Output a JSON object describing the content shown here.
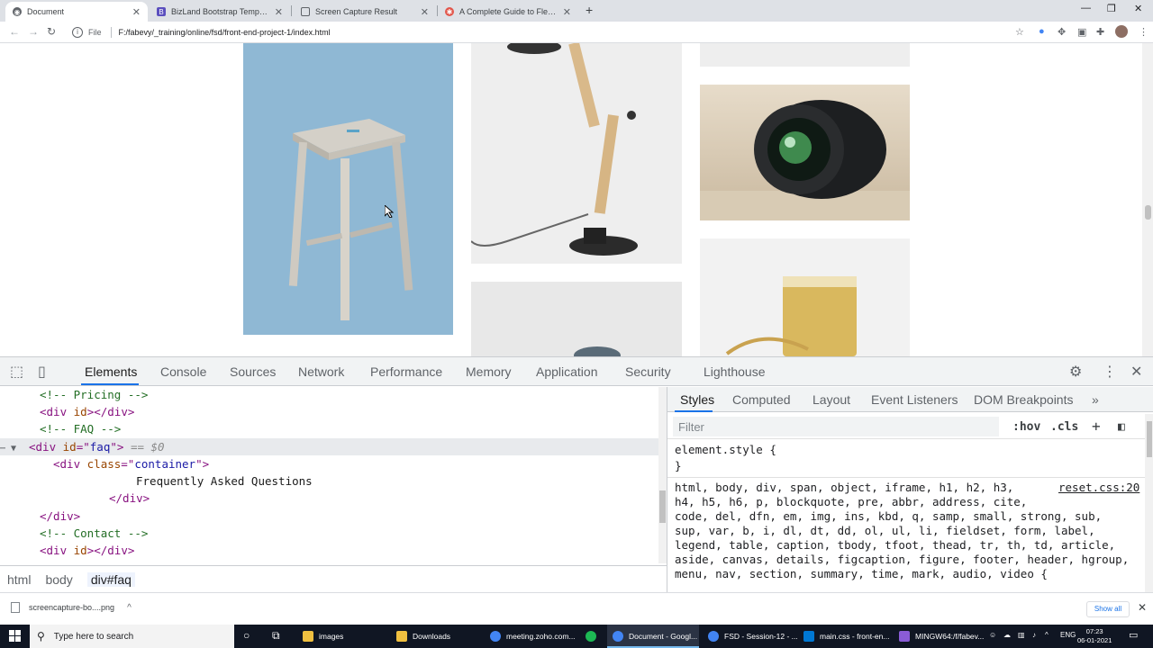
{
  "browser": {
    "tabs": [
      {
        "title": "Document",
        "active": true
      },
      {
        "title": "BizLand Bootstrap Template - Ind",
        "active": false
      },
      {
        "title": "Screen Capture Result",
        "active": false
      },
      {
        "title": "A Complete Guide to Flexbox | C",
        "active": false
      }
    ],
    "address": {
      "scheme_label": "File",
      "url": "F:/fabevy/_training/online/fsd/front-end-project-1/index.html"
    }
  },
  "devtools": {
    "tabs": [
      "Elements",
      "Console",
      "Sources",
      "Network",
      "Performance",
      "Memory",
      "Application",
      "Security",
      "Lighthouse"
    ],
    "active_tab": "Elements",
    "dom_lines": [
      {
        "comment": "<!-- Pricing -->"
      },
      {
        "tag": "div",
        "attr": "id",
        "value": ""
      },
      {
        "comment": "<!-- FAQ -->"
      },
      {
        "tag": "div",
        "attr": "id",
        "value": "faq",
        "selected_marker": "== $0"
      },
      {
        "tag": "div",
        "attr": "class",
        "value": "container"
      },
      {
        "text": "Frequently Asked Questions"
      },
      {
        "close": "</div>"
      },
      {
        "close": "</div>"
      },
      {
        "comment": "<!-- Contact -->"
      },
      {
        "tag": "div",
        "attr": "id",
        "value": ""
      }
    ],
    "breadcrumbs": [
      "html",
      "body",
      "div#faq"
    ],
    "styles_tabs": [
      "Styles",
      "Computed",
      "Layout",
      "Event Listeners",
      "DOM Breakpoints"
    ],
    "more_tabs": "»",
    "filter_placeholder": "Filter",
    "hov_label": ":hov",
    "cls_label": ".cls",
    "element_style_open": "element.style {",
    "element_style_close": "}",
    "reset_source": "reset.css:20",
    "reset_selectors": [
      "html, body, div, span, object, iframe, h1, h2, h3,",
      "h4, h5, h6, p, blockquote, pre, abbr, address, cite,",
      "code, del, dfn, em, img, ins, kbd, q, samp, small, strong, sub,",
      "sup, var, b, i, dl, dt, dd, ol, ul, li, fieldset, form, label,",
      "legend, table, caption, tbody, tfoot, thead, tr, th, td, article,",
      "aside, canvas, details, figcaption, figure, footer, header, hgroup,",
      "menu, nav, section, summary, time, mark, audio, video {"
    ]
  },
  "downloads": {
    "file": "screencapture-bo....png",
    "show_all": "Show all"
  },
  "taskbar": {
    "search_placeholder": "Type here to search",
    "apps": [
      {
        "label": "images",
        "color": "#f0c040"
      },
      {
        "label": "Downloads",
        "color": "#f0c040"
      },
      {
        "label": "meeting.zoho.com...",
        "color": "#4285f4"
      },
      {
        "label": "",
        "color": "#1db954"
      },
      {
        "label": "Document - Googl...",
        "color": "#4285f4"
      },
      {
        "label": "FSD - Session-12 - ...",
        "color": "#4285f4"
      },
      {
        "label": "main.css - front-en...",
        "color": "#0078d4"
      },
      {
        "label": "MINGW64:/f/fabev...",
        "color": "#8a5cd6"
      }
    ],
    "lang": "ENG",
    "time": "07:23",
    "date": "06-01-2021"
  },
  "colors": {
    "accent": "#1a73e8",
    "stool_bg": "#8fb8d4",
    "taskbar_bg": "#101623"
  }
}
